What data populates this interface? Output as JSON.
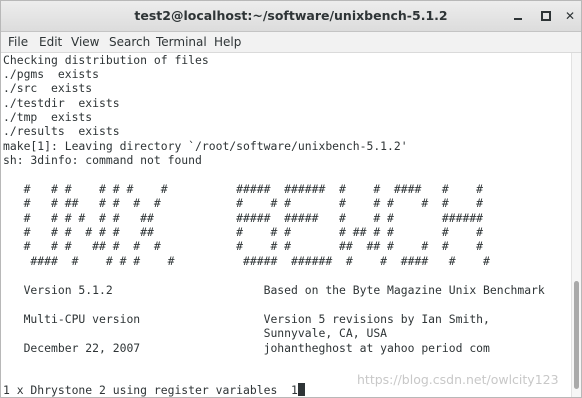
{
  "window": {
    "title": "test2@localhost:~/software/unixbench-5.1.2",
    "buttons": {
      "minimize": "minimize",
      "maximize": "maximize",
      "close": "✕"
    }
  },
  "menu": [
    "File",
    "Edit",
    "View",
    "Search",
    "Terminal",
    "Help"
  ],
  "terminal": {
    "lines": [
      "Checking distribution of files",
      "./pgms  exists",
      "./src  exists",
      "./testdir  exists",
      "./tmp  exists",
      "./results  exists",
      "make[1]: Leaving directory `/root/software/unixbench-5.1.2'",
      "sh: 3dinfo: command not found",
      "",
      "   #   # #    # # #    #          #####  ######  #    #  ####   #    #",
      "   #   # ##   # #  #  #           #    # #       #    # #    #  #    #",
      "   #   # # #  # #   ##            #####  #####   #    # #       ######",
      "   #   # #  # # #   ##            #    # #       # ## # #       #    #",
      "   #   # #   ## #  #  #           #    # #       ##  ## #    #  #    #",
      "    ####  #    # # #    #          #####  ######  #    #  ####   #    #",
      "",
      "   Version 5.1.2                      Based on the Byte Magazine Unix Benchmark",
      "",
      "   Multi-CPU version                  Version 5 revisions by Ian Smith,",
      "                                      Sunnyvale, CA, USA",
      "   December 22, 2007                  johantheghost at yahoo period com",
      "",
      "",
      "1 x Dhrystone 2 using register variables  1"
    ]
  },
  "watermark": "https://blog.csdn.net/owlcity123"
}
